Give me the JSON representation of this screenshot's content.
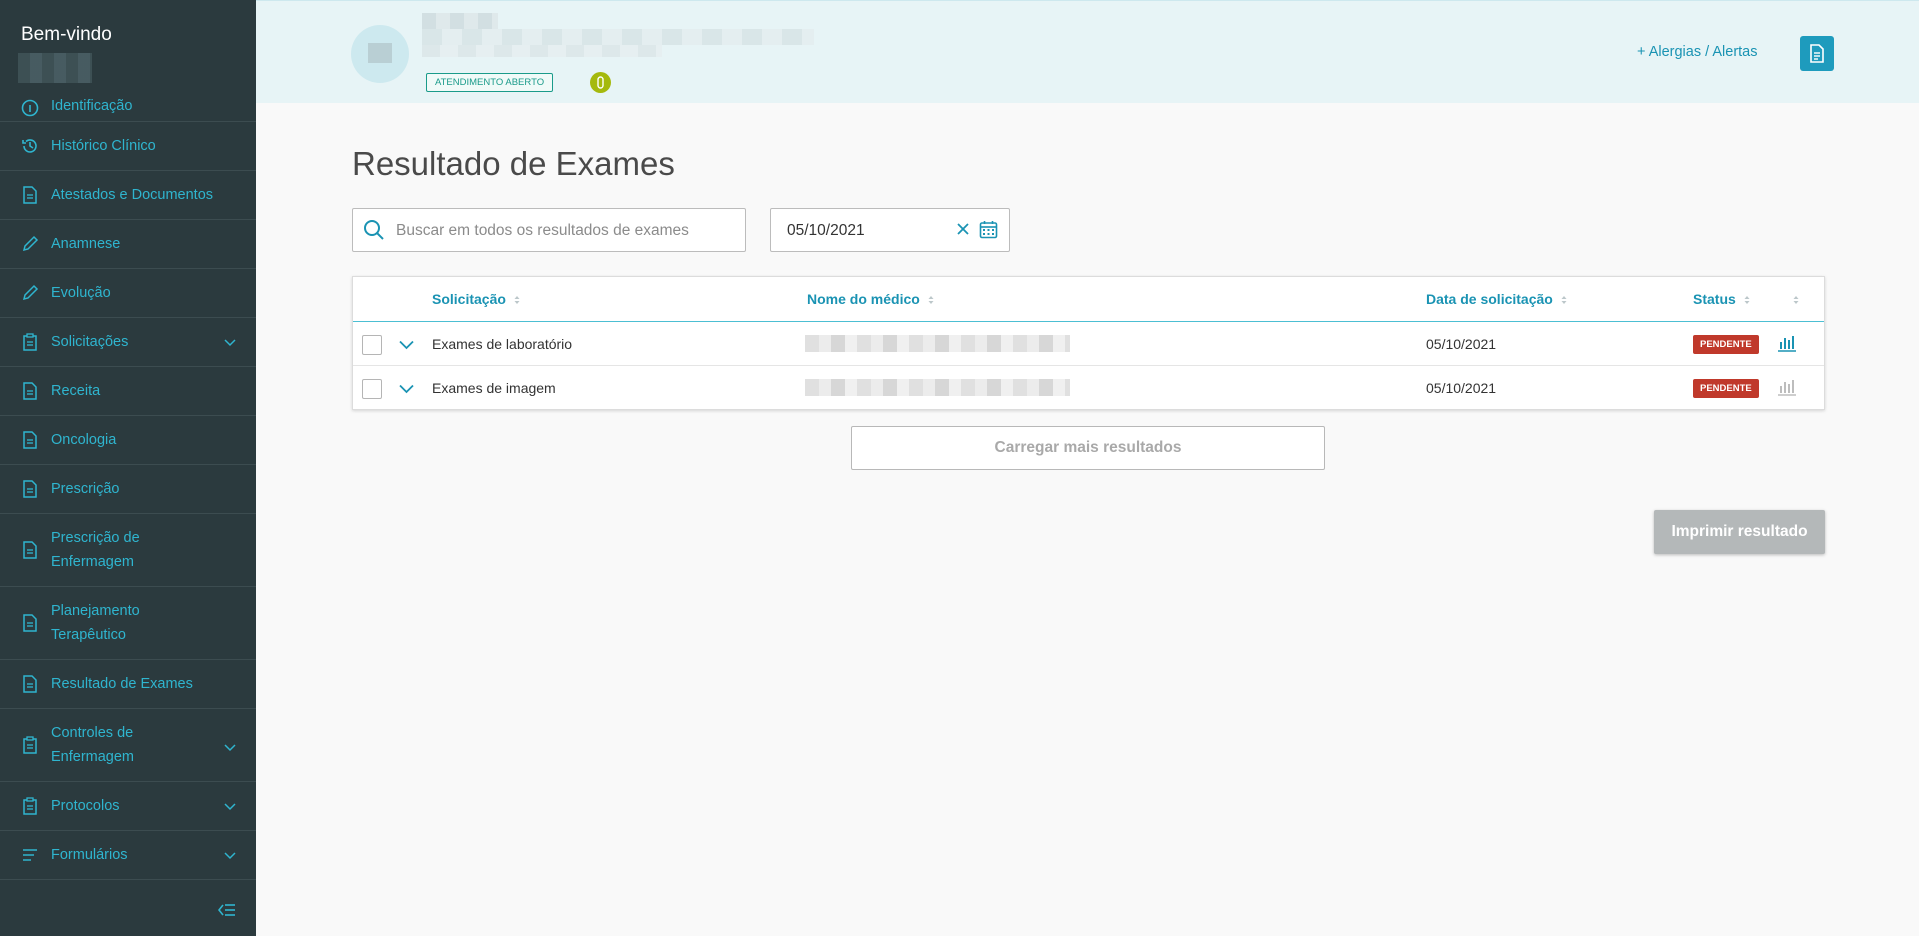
{
  "sidebar": {
    "welcome": "Bem-vindo",
    "items": [
      {
        "label": "Identificação",
        "icon": "info-icon"
      },
      {
        "label": "Histórico Clínico",
        "icon": "history-icon"
      },
      {
        "label": "Atestados e Documentos",
        "icon": "document-icon"
      },
      {
        "label": "Anamnese",
        "icon": "pencil-icon"
      },
      {
        "label": "Evolução",
        "icon": "pencil-icon"
      },
      {
        "label": "Solicitações",
        "icon": "clipboard-icon"
      },
      {
        "label": "Receita",
        "icon": "document-icon"
      },
      {
        "label": "Oncologia",
        "icon": "document-icon"
      },
      {
        "label": "Prescrição",
        "icon": "document-icon"
      },
      {
        "label_line1": "Prescrição de",
        "label_line2": "Enfermagem",
        "icon": "document-icon"
      },
      {
        "label_line1": "Planejamento",
        "label_line2": "Terapêutico",
        "icon": "document-icon"
      },
      {
        "label": "Resultado de Exames",
        "icon": "document-icon"
      },
      {
        "label_line1": "Controles de",
        "label_line2": "Enfermagem",
        "icon": "clipboard-icon"
      },
      {
        "label": "Protocolos",
        "icon": "clipboard-icon"
      },
      {
        "label": "Formulários",
        "icon": "list-icon"
      }
    ]
  },
  "header": {
    "status": "ATENDIMENTO ABERTO",
    "alert_count": "0",
    "allergies_link": "+  Alergias / Alertas"
  },
  "main": {
    "title": "Resultado de Exames",
    "search_placeholder": "Buscar em todos os resultados de exames",
    "date_value": "05/10/2021",
    "table": {
      "columns": [
        "Solicitação",
        "Nome do médico",
        "Data de solicitação",
        "Status"
      ],
      "rows": [
        {
          "solicitacao": "Exames de laboratório",
          "data": "05/10/2021",
          "status": "PENDENTE"
        },
        {
          "solicitacao": "Exames de imagem",
          "data": "05/10/2021",
          "status": "PENDENTE"
        }
      ]
    },
    "load_more": "Carregar mais resultados",
    "print": "Imprimir resultado"
  },
  "colors": {
    "sidebar_bg": "#2b3a3e",
    "accent": "#1a93b3",
    "header_bg": "#e7f4f6",
    "status_pending": "#c0392b"
  }
}
